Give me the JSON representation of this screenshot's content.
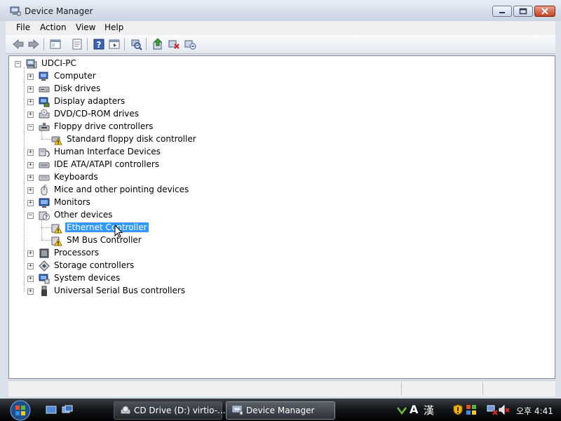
{
  "window": {
    "title": "Device Manager",
    "icon": "device-manager-icon"
  },
  "menu": [
    "File",
    "Action",
    "View",
    "Help"
  ],
  "toolbar": {
    "buttons": [
      "back-icon",
      "forward-icon",
      "up-level-icon",
      "properties-icon",
      "help-icon",
      "show-hide-console-tree-icon",
      "scan-hardware-icon",
      "update-driver-icon",
      "disable-device-icon",
      "uninstall-device-icon"
    ]
  },
  "tree": {
    "root": "UDCI-PC",
    "nodes": [
      {
        "label": "Computer",
        "icon": "computer-icon",
        "expanded": false
      },
      {
        "label": "Disk drives",
        "icon": "disk-drive-icon",
        "expanded": false
      },
      {
        "label": "Display adapters",
        "icon": "display-adapter-icon",
        "expanded": false
      },
      {
        "label": "DVD/CD-ROM drives",
        "icon": "dvd-drive-icon",
        "expanded": false
      },
      {
        "label": "Floppy drive controllers",
        "icon": "floppy-controller-icon",
        "expanded": true
      },
      {
        "label": "Standard floppy disk controller",
        "icon": "warning-device-icon",
        "child": true
      },
      {
        "label": "Human Interface Devices",
        "icon": "hid-icon",
        "expanded": false
      },
      {
        "label": "IDE ATA/ATAPI controllers",
        "icon": "ide-controller-icon",
        "expanded": false
      },
      {
        "label": "Keyboards",
        "icon": "keyboard-icon",
        "expanded": false
      },
      {
        "label": "Mice and other pointing devices",
        "icon": "mouse-icon",
        "expanded": false
      },
      {
        "label": "Monitors",
        "icon": "monitor-icon",
        "expanded": false
      },
      {
        "label": "Other devices",
        "icon": "unknown-device-icon",
        "expanded": true
      },
      {
        "label": "Ethernet Controller",
        "icon": "warning-device-icon",
        "child": true,
        "selected": true
      },
      {
        "label": "SM Bus Controller",
        "icon": "warning-device-icon",
        "child": true
      },
      {
        "label": "Processors",
        "icon": "processor-icon",
        "expanded": false
      },
      {
        "label": "Storage controllers",
        "icon": "storage-controller-icon",
        "expanded": false
      },
      {
        "label": "System devices",
        "icon": "system-devices-icon",
        "expanded": false
      },
      {
        "label": "Universal Serial Bus controllers",
        "icon": "usb-icon",
        "expanded": false
      }
    ]
  },
  "taskbar": {
    "tasks": [
      {
        "label": "CD Drive (D:) virtio-...",
        "icon": "cd-drive-icon",
        "active": false
      },
      {
        "label": "Device Manager",
        "icon": "device-manager-icon",
        "active": true
      }
    ],
    "tray": {
      "ime_mode": "A",
      "ime_hanja": "漢",
      "clock": "오후 4:41"
    }
  },
  "colors": {
    "selection": "#3399ff",
    "titlebar": "#d4dde9",
    "taskbar": "#15181c"
  }
}
